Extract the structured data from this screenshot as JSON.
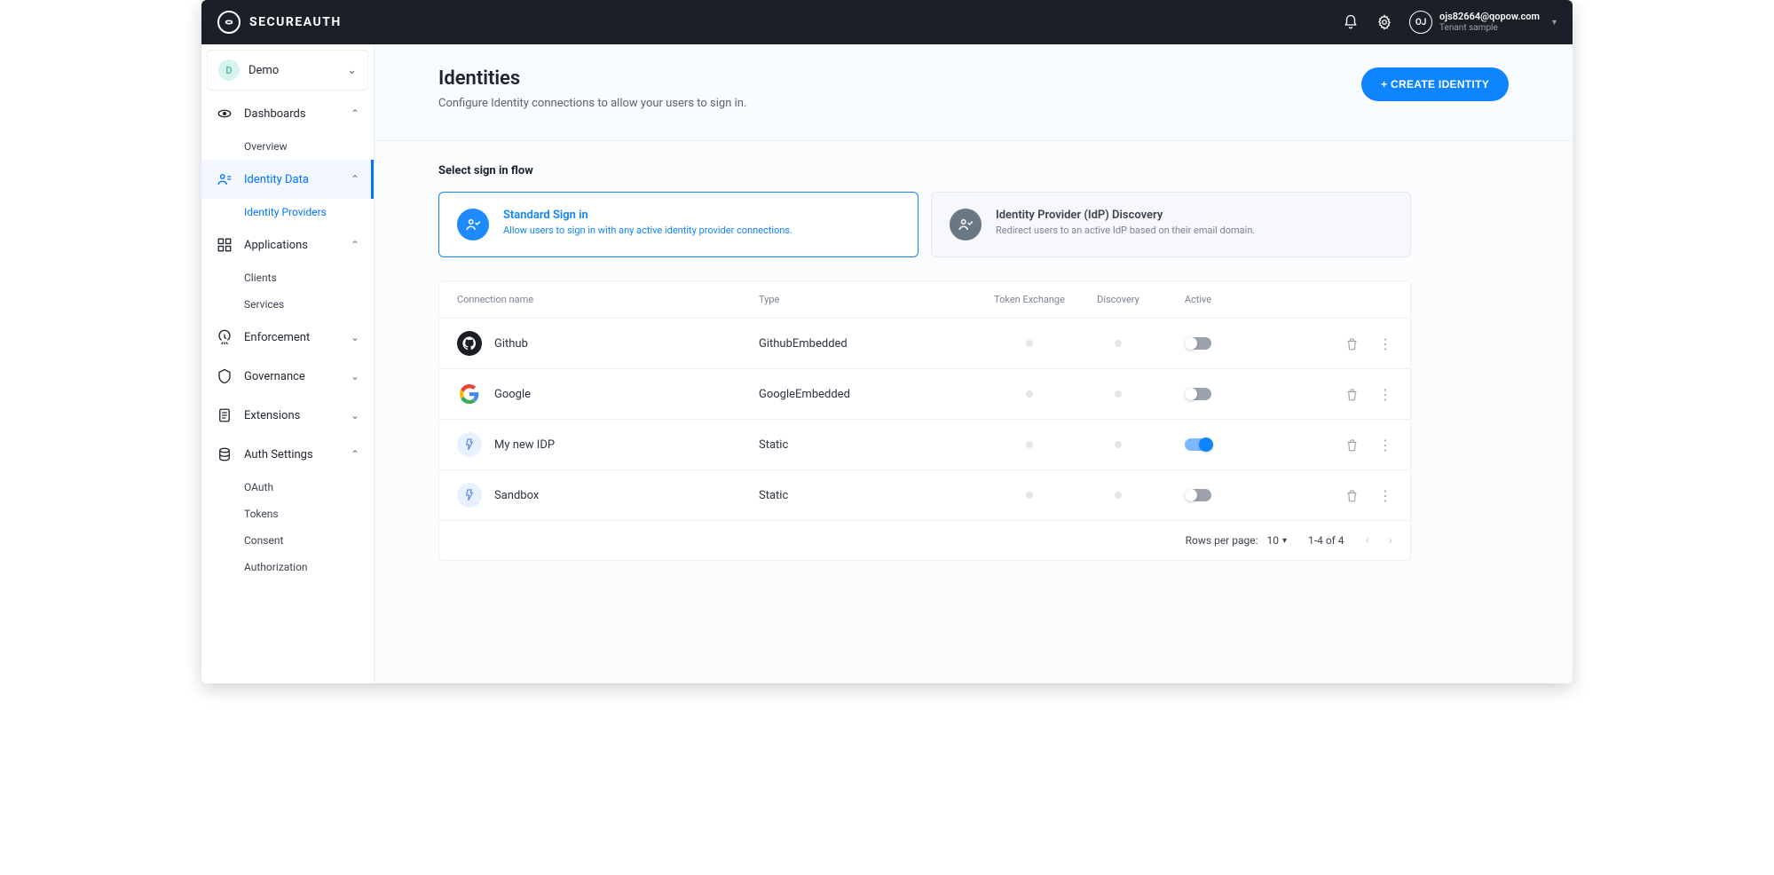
{
  "brand": "SECUREAUTH",
  "user": {
    "initials": "OJ",
    "email": "ojs82664@qopow.com",
    "tenant": "Tenant sample"
  },
  "workspace": {
    "badge": "D",
    "name": "Demo"
  },
  "sidebar": {
    "sections": [
      {
        "label": "Dashboards",
        "expanded": true,
        "items": [
          {
            "label": "Overview"
          }
        ]
      },
      {
        "label": "Identity Data",
        "expanded": true,
        "active": true,
        "items": [
          {
            "label": "Identity Providers",
            "active": true
          }
        ]
      },
      {
        "label": "Applications",
        "expanded": true,
        "items": [
          {
            "label": "Clients"
          },
          {
            "label": "Services"
          }
        ]
      },
      {
        "label": "Enforcement",
        "expanded": false
      },
      {
        "label": "Governance",
        "expanded": false
      },
      {
        "label": "Extensions",
        "expanded": false
      },
      {
        "label": "Auth Settings",
        "expanded": true,
        "items": [
          {
            "label": "OAuth"
          },
          {
            "label": "Tokens"
          },
          {
            "label": "Consent"
          },
          {
            "label": "Authorization"
          }
        ]
      }
    ]
  },
  "page": {
    "title": "Identities",
    "subtitle": "Configure Identity connections to allow your users to sign in.",
    "create_button": "+ CREATE IDENTITY"
  },
  "flow": {
    "title": "Select sign in flow",
    "options": [
      {
        "title": "Standard Sign in",
        "desc": "Allow users to sign in with any active identity provider connections.",
        "selected": true
      },
      {
        "title": "Identity Provider (IdP) Discovery",
        "desc": "Redirect users to an active IdP based on their email domain.",
        "selected": false
      }
    ]
  },
  "table": {
    "headers": {
      "name": "Connection name",
      "type": "Type",
      "token": "Token Exchange",
      "discovery": "Discovery",
      "active": "Active"
    },
    "rows": [
      {
        "name": "Github",
        "type": "GithubEmbedded",
        "token": false,
        "discovery": false,
        "active": false,
        "icon": "github"
      },
      {
        "name": "Google",
        "type": "GoogleEmbedded",
        "token": false,
        "discovery": false,
        "active": false,
        "icon": "google"
      },
      {
        "name": "My new IDP",
        "type": "Static",
        "token": false,
        "discovery": false,
        "active": true,
        "icon": "generic"
      },
      {
        "name": "Sandbox",
        "type": "Static",
        "token": false,
        "discovery": false,
        "active": false,
        "icon": "generic"
      }
    ],
    "footer": {
      "rpp_label": "Rows per page:",
      "rpp_value": "10",
      "range": "1-4 of 4"
    }
  }
}
